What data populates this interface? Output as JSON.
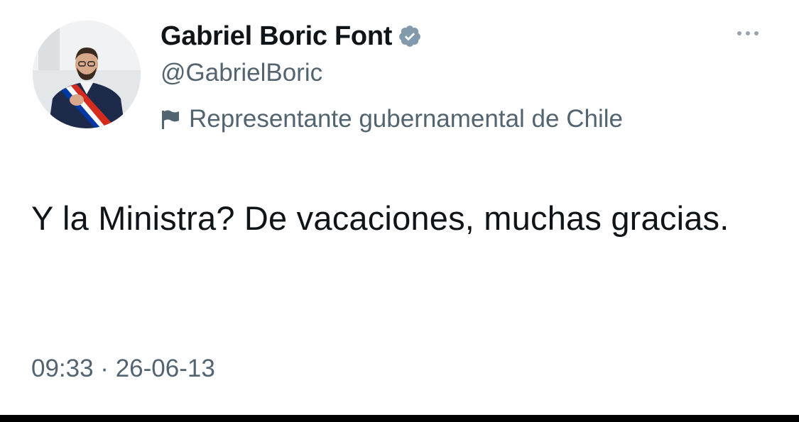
{
  "tweet": {
    "author": {
      "display_name": "Gabriel Boric Font",
      "handle": "@GabrielBoric",
      "verified": true,
      "label": "Representante gubernamental de Chile",
      "label_icon": "flag-icon",
      "avatar": "avatar-photo"
    },
    "text": "Y la Ministra? De vacaciones, muchas gracias.",
    "timestamp": "09:33 · 26-06-13",
    "more_icon": "more-options-icon"
  },
  "colors": {
    "text_primary": "#0f1419",
    "text_secondary": "#536471",
    "verified_badge": "#829aab",
    "background": "#ffffff"
  }
}
